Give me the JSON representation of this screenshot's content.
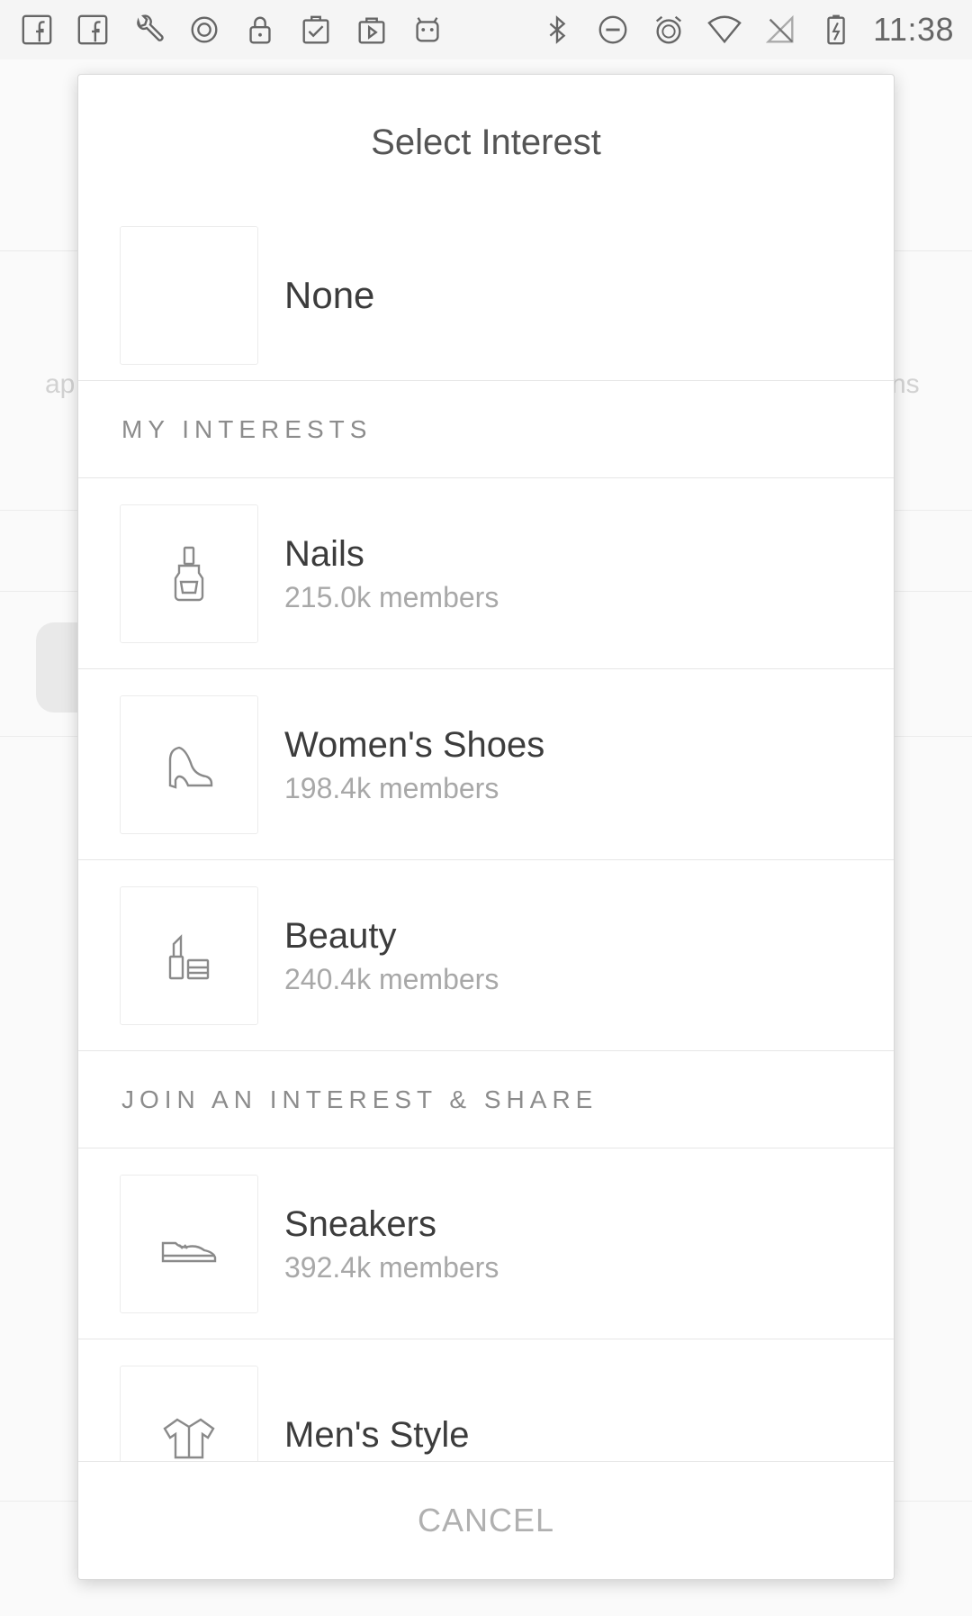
{
  "status_bar": {
    "left_icons": [
      "facebook-icon",
      "facebook-icon",
      "wrench-icon",
      "circle-badge-icon",
      "lock-icon",
      "clipboard-check-icon",
      "play-bag-icon",
      "android-icon"
    ],
    "right_icons": [
      "bluetooth-icon",
      "do-not-disturb-icon",
      "alarm-icon",
      "wifi-icon",
      "no-signal-icon",
      "battery-charging-icon"
    ],
    "time": "11:38"
  },
  "background": {
    "left_text": "ap",
    "right_text": "ns"
  },
  "dialog": {
    "title": "Select Interest",
    "none_option": {
      "label": "None"
    },
    "sections": [
      {
        "header": "MY INTERESTS",
        "items": [
          {
            "name": "Nails",
            "members": "215.0k members",
            "icon": "nail-polish-icon"
          },
          {
            "name": "Women's Shoes",
            "members": "198.4k members",
            "icon": "high-heel-icon"
          },
          {
            "name": "Beauty",
            "members": "240.4k members",
            "icon": "lipstick-icon"
          }
        ]
      },
      {
        "header": "JOIN AN INTEREST & SHARE",
        "items": [
          {
            "name": "Sneakers",
            "members": "392.4k members",
            "icon": "sneaker-icon"
          },
          {
            "name": "Men's Style",
            "members": "",
            "icon": "shirt-icon"
          }
        ]
      }
    ],
    "cancel_label": "CANCEL"
  },
  "colors": {
    "dialog_background": "#ffffff",
    "divider": "#e6e6e6",
    "title_text": "#555555",
    "secondary_text": "#a8a8a8",
    "cancel_text": "#b0b0b0"
  }
}
